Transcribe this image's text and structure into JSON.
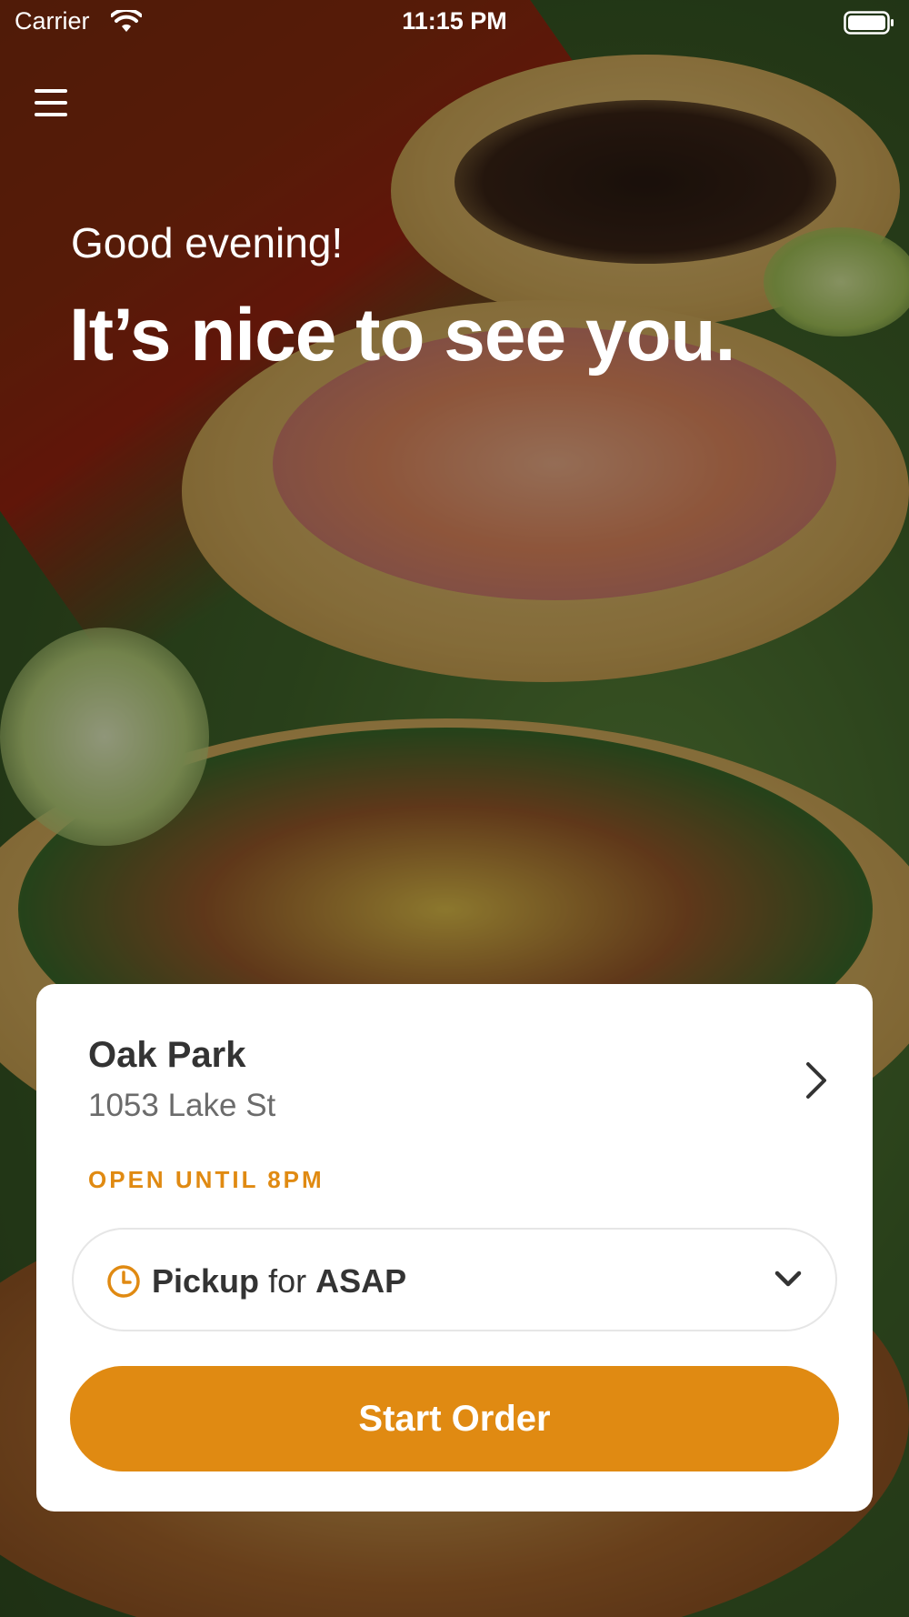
{
  "status_bar": {
    "carrier": "Carrier",
    "time": "11:15 PM"
  },
  "header": {
    "menu_icon": "hamburger-menu-icon",
    "greeting": "Good evening!",
    "headline": "It’s nice to see you."
  },
  "location_card": {
    "store_name": "Oak Park",
    "address": "1053 Lake St",
    "hours": "OPEN UNTIL 8PM",
    "order_mode": {
      "mode": "Pickup",
      "connector": "for",
      "time": "ASAP",
      "icon": "clock-icon"
    },
    "start_button_label": "Start Order"
  },
  "colors": {
    "accent": "#e08a12",
    "card_background": "#ffffff",
    "text_primary": "#333333",
    "text_secondary": "#6b6b6b"
  }
}
